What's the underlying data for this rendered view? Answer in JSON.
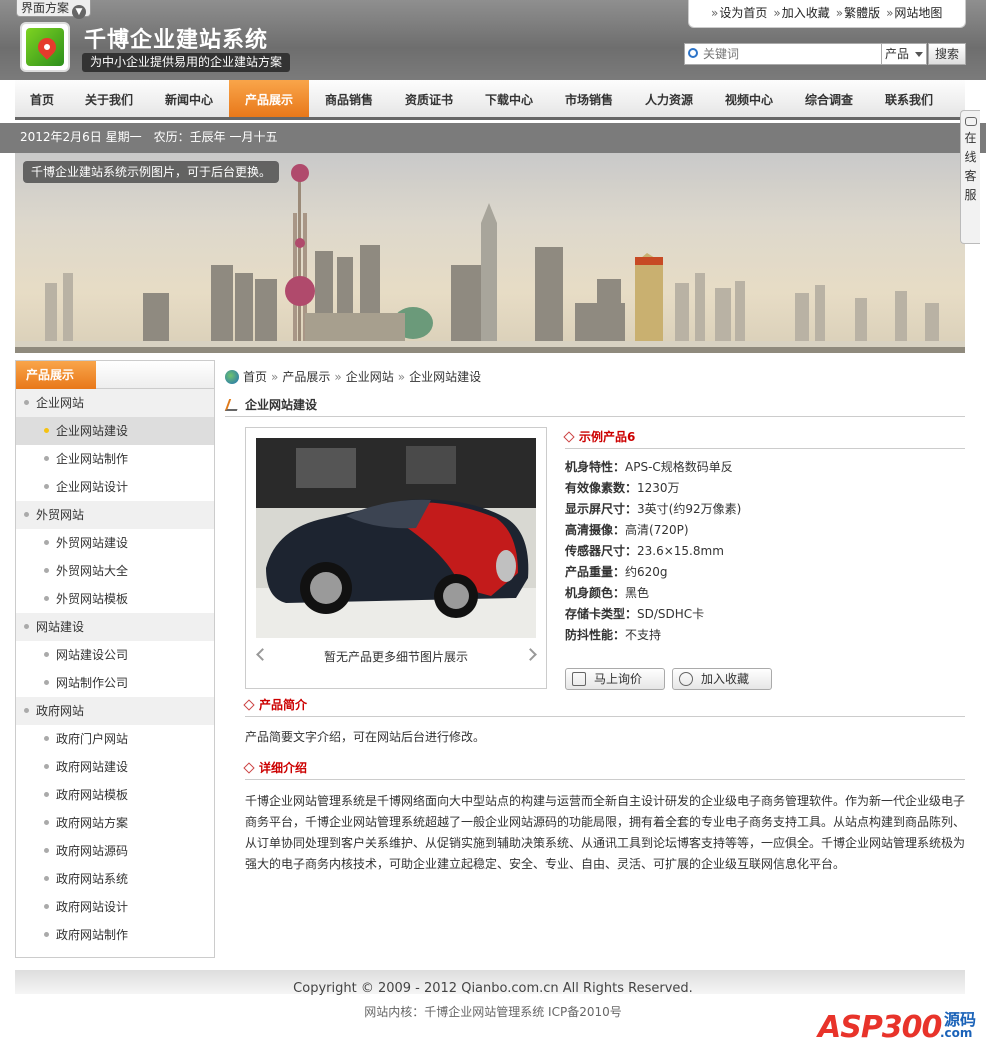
{
  "header": {
    "scheme_label": "界面方案",
    "site_title": "千博企业建站系统",
    "slogan": "为中小企业提供易用的企业建站方案",
    "top_links": [
      "设为首页",
      "加入收藏",
      "繁體版",
      "网站地图"
    ],
    "search": {
      "placeholder": "关键词",
      "category": "产品",
      "button": "搜索"
    }
  },
  "nav": [
    "首页",
    "关于我们",
    "新闻中心",
    "产品展示",
    "商品销售",
    "资质证书",
    "下载中心",
    "市场销售",
    "人力资源",
    "视频中心",
    "综合调查",
    "联系我们"
  ],
  "nav_active_index": 3,
  "datebar": "2012年2月6日 星期一　农历：壬辰年 一月十五",
  "banner_caption": "千博企业建站系统示例图片，可于后台更换。",
  "service": [
    "在",
    "线",
    "客",
    "服"
  ],
  "sidebar": {
    "title": "产品展示",
    "groups": [
      {
        "name": "企业网站",
        "items": [
          "企业网站建设",
          "企业网站制作",
          "企业网站设计"
        ]
      },
      {
        "name": "外贸网站",
        "items": [
          "外贸网站建设",
          "外贸网站大全",
          "外贸网站模板"
        ]
      },
      {
        "name": "网站建设",
        "items": [
          "网站建设公司",
          "网站制作公司"
        ]
      },
      {
        "name": "政府网站",
        "items": [
          "政府门户网站",
          "政府网站建设",
          "政府网站模板",
          "政府网站方案",
          "政府网站源码",
          "政府网站系统",
          "政府网站设计",
          "政府网站制作"
        ]
      }
    ],
    "active_item": "企业网站建设"
  },
  "breadcrumb": [
    "首页",
    "产品展示",
    "企业网站",
    "企业网站建设"
  ],
  "section_title": "企业网站建设",
  "product": {
    "name": "示例产品6",
    "thumb_note": "暂无产品更多细节图片展示",
    "specs": [
      {
        "label": "机身特性：",
        "value": "APS-C规格数码单反"
      },
      {
        "label": "有效像素数：",
        "value": "1230万"
      },
      {
        "label": "显示屏尺寸：",
        "value": "3英寸(约92万像素)"
      },
      {
        "label": "高清摄像：",
        "value": "高清(720P)"
      },
      {
        "label": "传感器尺寸：",
        "value": "23.6×15.8mm"
      },
      {
        "label": "产品重量：",
        "value": "约620g"
      },
      {
        "label": "机身颜色：",
        "value": "黑色"
      },
      {
        "label": "存储卡类型：",
        "value": "SD/SDHC卡"
      },
      {
        "label": "防抖性能：",
        "value": "不支持"
      }
    ],
    "inquire_label": "马上询价",
    "favorite_label": "加入收藏"
  },
  "intro": {
    "title": "产品简介",
    "text": "产品简要文字介绍，可在网站后台进行修改。"
  },
  "detail": {
    "title": "详细介绍",
    "text": "千博企业网站管理系统是千博网络面向大中型站点的构建与运营而全新自主设计研发的企业级电子商务管理软件。作为新一代企业级电子商务平台，千博企业网站管理系统超越了一般企业网站源码的功能局限，拥有着全套的专业电子商务支持工具。从站点构建到商品陈列、从订单协同处理到客户关系维护、从促销实施到辅助决策系统、从通讯工具到论坛博客支持等等，一应俱全。千博企业网站管理系统极为强大的电子商务内核技术，可助企业建立起稳定、安全、专业、自由、灵活、可扩展的企业级互联网信息化平台。"
  },
  "footer": {
    "copyright": "Copyright © 2009 - 2012 Qianbo.com.cn All Rights Reserved.",
    "icp": "网站内核：千博企业网站管理系统 ICP备2010号"
  },
  "watermark": {
    "brand": "ASP300",
    "tag": "源码",
    "domain": ".com"
  },
  "colors": {
    "accent": "#e8781a",
    "title_red": "#cc0000",
    "header_gray": "#7b7b7b"
  }
}
